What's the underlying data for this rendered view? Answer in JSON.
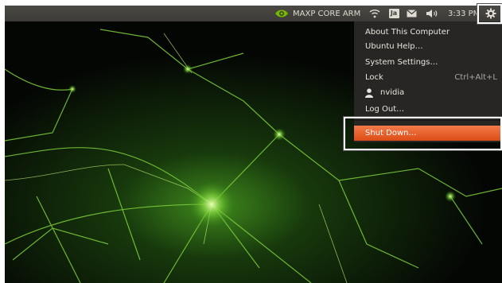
{
  "panel": {
    "app_label": "MAXP CORE ARM",
    "keyboard_layout": "Ja",
    "clock": "3:33 PM",
    "background": "#3c3b37",
    "text_color": "#dfdbd2"
  },
  "menu": {
    "about": "About This Computer",
    "help": "Ubuntu Help…",
    "settings": "System Settings…",
    "lock": "Lock",
    "lock_shortcut": "Ctrl+Alt+L",
    "user": "nvidia",
    "logout": "Log Out…",
    "shutdown": "Shut Down…",
    "highlight_color": "#dd4c15"
  },
  "icons": [
    "nvidia-icon",
    "wifi-icon",
    "mail-icon",
    "volume-icon",
    "gear-icon",
    "user-icon"
  ]
}
